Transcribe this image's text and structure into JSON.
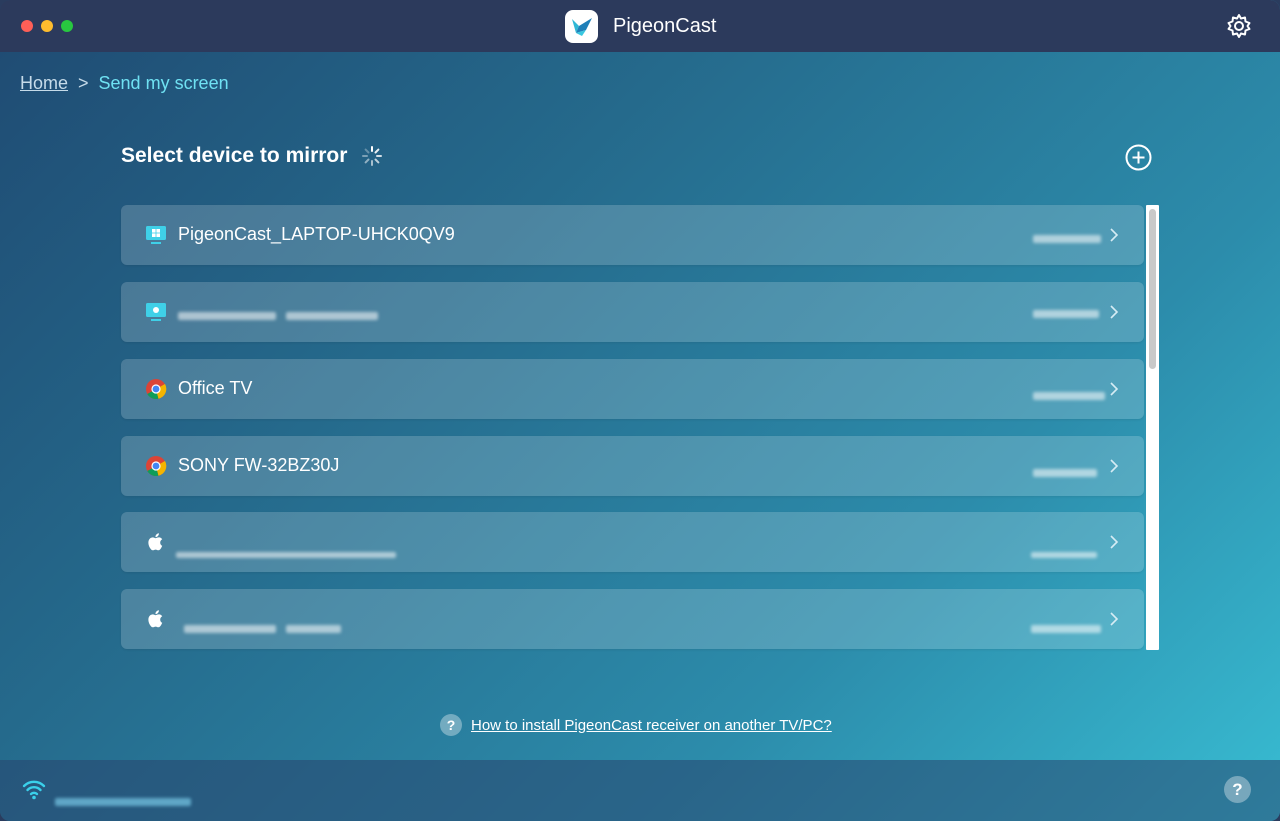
{
  "app": {
    "title": "PigeonCast"
  },
  "breadcrumb": {
    "home": "Home",
    "separator": ">",
    "current": "Send my screen"
  },
  "section": {
    "title": "Select device to mirror"
  },
  "devices": [
    {
      "name": "PigeonCast_LAPTOP-UHCK0QV9",
      "icon": "windows-icon"
    },
    {
      "name": "",
      "icon": "monitor-icon"
    },
    {
      "name": "Office TV",
      "icon": "chrome-icon"
    },
    {
      "name": "SONY FW-32BZ30J",
      "icon": "chrome-icon"
    },
    {
      "name": "",
      "icon": "apple-icon"
    },
    {
      "name": "",
      "icon": "apple-icon"
    }
  ],
  "help": {
    "link_text": "How to install PigeonCast receiver on another TV/PC?",
    "icon_glyph": "?"
  },
  "footer": {
    "help_glyph": "?"
  },
  "colors": {
    "accent": "#6fe1f2",
    "titlebar": "#2c3a5c",
    "wifi": "#3ad0ea"
  }
}
